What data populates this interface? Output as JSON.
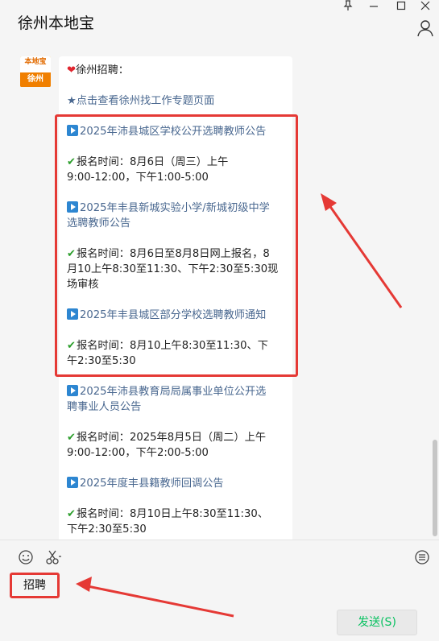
{
  "window": {
    "title": "徐州本地宝",
    "controls": [
      "pin-icon",
      "minimize-icon",
      "maximize-icon",
      "close-icon"
    ]
  },
  "avatar": {
    "top_text": "本地宝",
    "bottom_text": "徐州"
  },
  "message": {
    "header": "徐州招聘：",
    "intro": "★点击查看徐州找工作专题页面",
    "items": [
      {
        "title": "2025年沛县城区学校公开选聘教师公告",
        "info": [
          "报名时间：8月6日（周三）上午",
          "9:00-12:00，下午1:00-5:00"
        ]
      },
      {
        "title": [
          "2025年丰县新城实验小学/新城初级中学",
          "选聘教师公告"
        ],
        "info": [
          "报名时间：8月6日至8月8日网上报名，8",
          "月10上午8:30至11:30、下午2:30至5:30现",
          "场审核"
        ]
      },
      {
        "title": "2025年丰县城区部分学校选聘教师通知",
        "info": [
          "报名时间：8月10上午8:30至11:30、下",
          "午2:30至5:30"
        ]
      },
      {
        "title": [
          "2025年沛县教育局局属事业单位公开选",
          "聘事业人员公告"
        ],
        "info": [
          "报名时间：2025年8月5日（周二）上午",
          "9:00-12:00，下午2:00-5:00"
        ]
      },
      {
        "title": "2025年度丰县籍教师回调公告",
        "info": [
          "报名时间：8月10日上午8:30至11:30、",
          "下午2:30至5:30"
        ]
      }
    ]
  },
  "input": {
    "text": "招聘",
    "send_label": "发送(S)"
  },
  "colors": {
    "highlight": "#e53935",
    "link": "#4a6890",
    "send_text": "#07c160"
  }
}
